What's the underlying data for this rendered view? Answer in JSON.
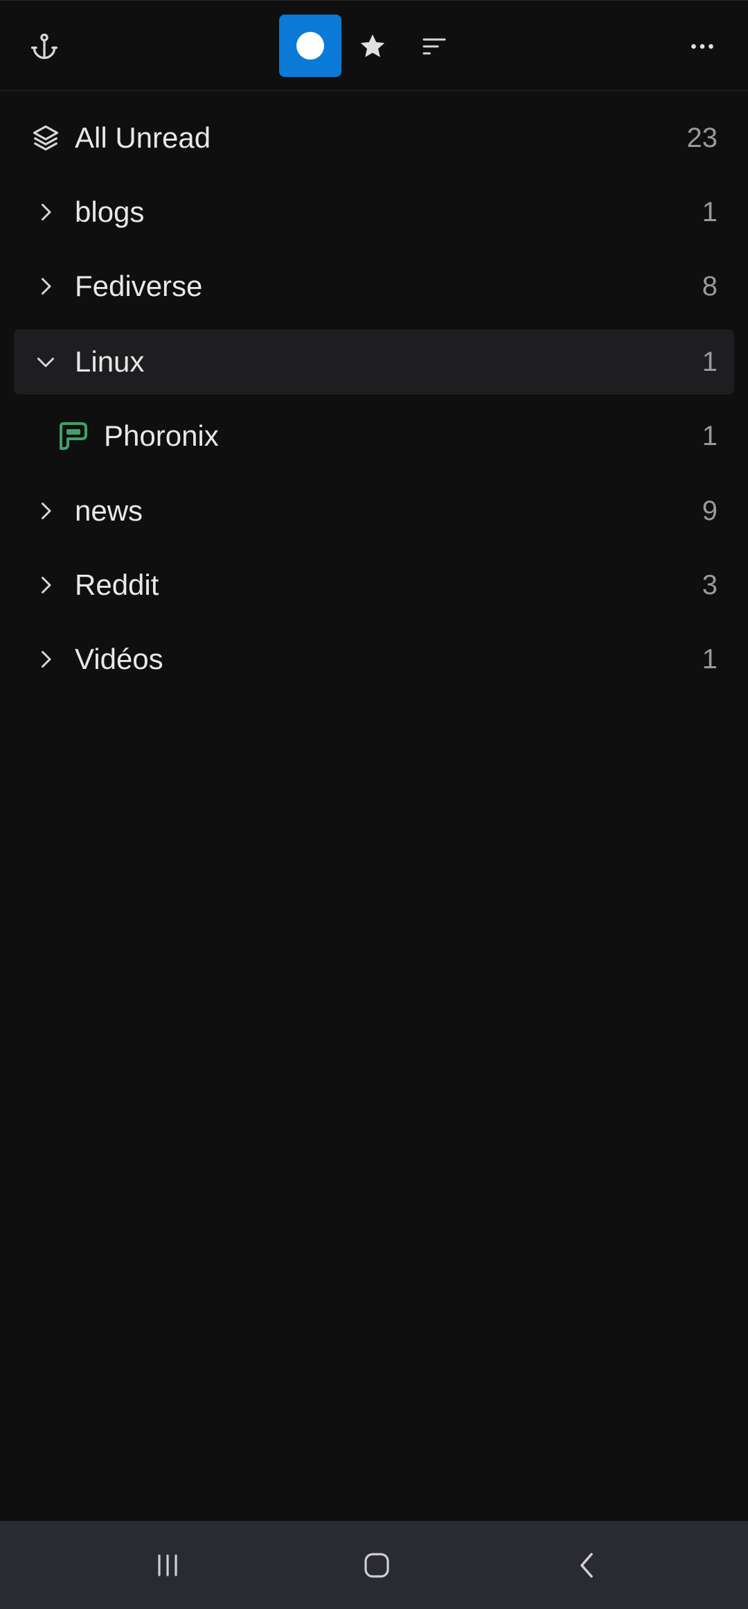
{
  "toolbar": {
    "icons": [
      "anchor-icon",
      "unread-dot-icon",
      "star-icon",
      "sort-icon",
      "more-icon"
    ],
    "accent_color": "#0a7ad6"
  },
  "feeds": [
    {
      "label": "All Unread",
      "count": "23",
      "icon": "layers-icon"
    },
    {
      "label": "blogs",
      "count": "1",
      "icon": "chevron-right-icon"
    },
    {
      "label": "Fediverse",
      "count": "8",
      "icon": "chevron-right-icon"
    },
    {
      "label": "Linux",
      "count": "1",
      "icon": "chevron-down-icon",
      "expanded": true
    },
    {
      "label": "Phoronix",
      "count": "1",
      "icon": "phoronix-logo-icon"
    },
    {
      "label": "news",
      "count": "9",
      "icon": "chevron-right-icon"
    },
    {
      "label": "Reddit",
      "count": "3",
      "icon": "chevron-right-icon"
    },
    {
      "label": "Vidéos",
      "count": "1",
      "icon": "chevron-right-icon"
    }
  ],
  "navbar": {
    "icons": [
      "recent-apps-icon",
      "home-icon",
      "back-icon"
    ]
  }
}
